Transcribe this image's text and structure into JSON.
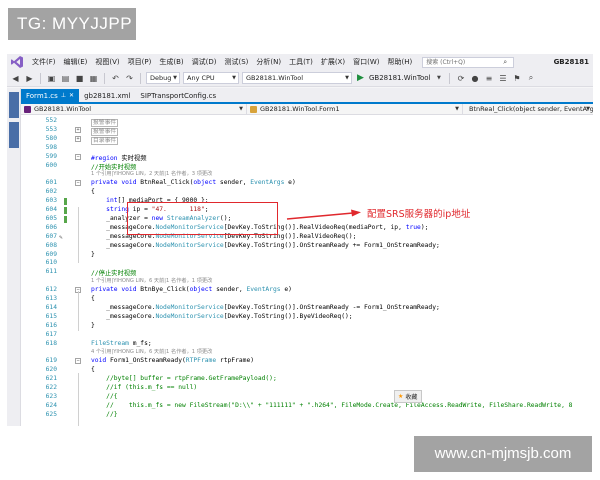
{
  "badge": {
    "text": "TG: MYYJJPP"
  },
  "watermark": {
    "text": "www.cn-mjmsjb.com"
  },
  "menubar": {
    "items": [
      "文件(F)",
      "编辑(E)",
      "视图(V)",
      "项目(P)",
      "生成(B)",
      "调试(D)",
      "测试(S)",
      "分析(N)",
      "工具(T)",
      "扩展(X)",
      "窗口(W)",
      "帮助(H)"
    ],
    "search_placeholder": "搜索 (Ctrl+Q)",
    "window_title": "GB28181"
  },
  "toolbar": {
    "config": "Debug",
    "platform": "Any CPU",
    "project": "GB28181.WinTool",
    "run_label": "GB28181.WinTool"
  },
  "tabs": [
    {
      "label": "Form1.cs",
      "active": true
    },
    {
      "label": "gb28181.xml",
      "active": false
    },
    {
      "label": "SIPTransportConfig.cs",
      "active": false
    }
  ],
  "navbar": {
    "project": "GB28181.WinTool",
    "class": "GB28181.WinTool.Form1",
    "member": "BtnReal_Click(object sender, EventArgs e)"
  },
  "code_lines": [
    {
      "num": "552",
      "html": "<span class='region-box'>报警事件</span>",
      "type": "code"
    },
    {
      "num": "553",
      "html": "<span class='region-box'>报警事件</span>",
      "type": "code"
    },
    {
      "num": "580",
      "html": "<span class='region-box'>目录事件</span>",
      "type": "code"
    },
    {
      "num": "598",
      "html": "",
      "type": "code"
    },
    {
      "num": "599",
      "html": "<span class='kw'>#region</span> 实时视频",
      "type": "code"
    },
    {
      "num": "600",
      "html": "<span class='cm'>//开始实时视频</span>",
      "type": "code"
    },
    {
      "num": "",
      "html": "1 个引用|YIHONG LIN，2 天前|1 名作者，3 项更改",
      "type": "lens"
    },
    {
      "num": "601",
      "html": "<span class='kw'>private void</span> BtnReal_Click(<span class='kw'>object</span> sender, <span class='ty'>EventArgs</span> e)",
      "type": "code"
    },
    {
      "num": "602",
      "html": "{",
      "type": "code"
    },
    {
      "num": "603",
      "html": "    <span class='kw'>int</span>[] mediaPort = { 9000 };",
      "type": "code"
    },
    {
      "num": "604",
      "html": "    <span class='kw'>string</span> ip = <span class='st'>\"47.      118\"</span>;",
      "type": "code"
    },
    {
      "num": "605",
      "html": "    _analyzer = <span class='kw'>new</span> <span class='ty'>StreamAnalyzer</span>();",
      "type": "code"
    },
    {
      "num": "606",
      "html": "    _messageCore.<span class='ty'>NodeMonitorService</span>[DevKey.ToString()].RealVideoReq(mediaPort, ip, <span class='kw'>true</span>);",
      "type": "code"
    },
    {
      "num": "607",
      "html": "    _messageCore.<span class='ty'>NodeMonitorService</span>[DevKey.ToString()].RealVideoReq();",
      "type": "code"
    },
    {
      "num": "608",
      "html": "    _messageCore.<span class='ty'>NodeMonitorService</span>[DevKey.ToString()].OnStreamReady += Form1_OnStreamReady;",
      "type": "code"
    },
    {
      "num": "609",
      "html": "}",
      "type": "code"
    },
    {
      "num": "610",
      "html": "",
      "type": "code"
    },
    {
      "num": "611",
      "html": "<span class='cm'>//停止实时视频</span>",
      "type": "code"
    },
    {
      "num": "",
      "html": "1 个引用|YIHONG LIN，6 天前|1 名作者，1 项更改",
      "type": "lens"
    },
    {
      "num": "612",
      "html": "<span class='kw'>private void</span> BtnBye_Click(<span class='kw'>object</span> sender, <span class='ty'>EventArgs</span> e)",
      "type": "code"
    },
    {
      "num": "613",
      "html": "{",
      "type": "code"
    },
    {
      "num": "614",
      "html": "    _messageCore.<span class='ty'>NodeMonitorService</span>[DevKey.ToString()].OnStreamReady -= Form1_OnStreamReady;",
      "type": "code"
    },
    {
      "num": "615",
      "html": "    _messageCore.<span class='ty'>NodeMonitorService</span>[DevKey.ToString()].ByeVideoReq();",
      "type": "code"
    },
    {
      "num": "616",
      "html": "}",
      "type": "code"
    },
    {
      "num": "617",
      "html": "",
      "type": "code"
    },
    {
      "num": "618",
      "html": "<span class='ty'>FileStream</span> m_fs;",
      "type": "code"
    },
    {
      "num": "",
      "html": "4 个引用|YIHONG LIN，6 天前|1 名作者，1 项更改",
      "type": "lens"
    },
    {
      "num": "619",
      "html": "<span class='kw'>void</span> Form1_OnStreamReady(<span class='ty'>RTPFrame</span> rtpFrame)",
      "type": "code"
    },
    {
      "num": "620",
      "html": "{",
      "type": "code"
    },
    {
      "num": "621",
      "html": "    <span class='cm'>//byte[] buffer = rtpFrame.GetFramePayload();</span>",
      "type": "code"
    },
    {
      "num": "622",
      "html": "    <span class='cm'>//if (this.m_fs == null)</span>",
      "type": "code"
    },
    {
      "num": "623",
      "html": "    <span class='cm'>//{</span>",
      "type": "code"
    },
    {
      "num": "624",
      "html": "    <span class='cm'>//    this.m_fs = new FileStream(\"D:\\\\\" + \"111111\" + \".h264\", FileMode.Create, FileAccess.ReadWrite, FileShare.ReadWrite, 8</span>",
      "type": "code"
    },
    {
      "num": "625",
      "html": "    <span class='cm'>//}</span>",
      "type": "code"
    }
  ],
  "annotation": {
    "text": "配置SRS服务器的ip地址"
  },
  "popup": {
    "text": "收藏"
  }
}
